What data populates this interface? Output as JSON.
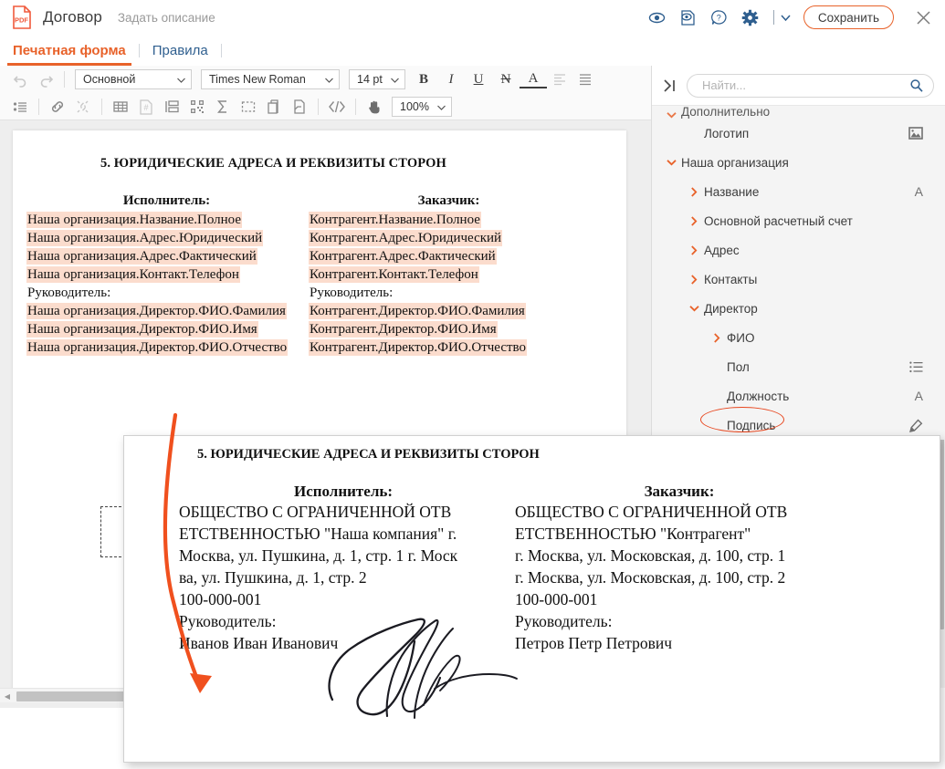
{
  "topbar": {
    "app_icon": "pdf-file-icon",
    "title": "Договор",
    "description_placeholder": "Задать описание",
    "icons": [
      {
        "name": "eye-icon",
        "label": "Просмотр"
      },
      {
        "name": "preview-page-icon",
        "label": "Предпросмотр"
      },
      {
        "name": "help-icon",
        "label": "Справка"
      },
      {
        "name": "gear-icon",
        "label": "Настройки"
      }
    ],
    "dropdown_caret": "chevron-down-icon",
    "save_label": "Сохранить",
    "close_label": "×"
  },
  "tabs": [
    {
      "label": "Печатная форма",
      "active": true
    },
    {
      "label": "Правила",
      "active": false
    }
  ],
  "toolbar": {
    "undo": "undo-icon",
    "redo": "redo-icon",
    "style_value": "Основной",
    "font_value": "Times New Roman",
    "size_value": "14 pt",
    "bold": "B",
    "italic": "I",
    "underline": "U",
    "strikethrough": "N",
    "font_color": "A",
    "align_left": "align-left-icon",
    "align_justify": "align-justify-icon",
    "list": "bullet-list-icon",
    "link": "link-icon",
    "unlink": "unlink-icon",
    "table": "table-icon",
    "page_number": "page-number-icon",
    "paragraph": "paragraph-icon",
    "barcode": "qr-code-icon",
    "sum": "sum-icon",
    "selection": "selection-icon",
    "copy_page": "copy-page-icon",
    "page_break": "page-break-icon",
    "code": "code-icon",
    "hand": "hand-icon",
    "zoom_value": "100%"
  },
  "document": {
    "section_title": "5. ЮРИДИЧЕСКИЕ АДРЕСА И РЕКВИЗИТЫ СТОРОН",
    "left_column": {
      "header": "Исполнитель:",
      "lines": [
        {
          "text": "Наша организация.Название.Полное",
          "field": true
        },
        {
          "text": "Наша организация.Адрес.Юридический",
          "field": true
        },
        {
          "text": "Наша организация.Адрес.Фактический",
          "field": true
        },
        {
          "text": "Наша организация.Контакт.Телефон",
          "field": true
        },
        {
          "text": "Руководитель:",
          "field": false
        },
        {
          "text": "Наша организация.Директор.ФИО.Фамилия",
          "field": true
        },
        {
          "text": "Наша организация.Директор.ФИО.Имя",
          "field": true
        },
        {
          "text": "Наша организация.Директор.ФИО.Отчество",
          "field": true
        }
      ]
    },
    "right_column": {
      "header": "Заказчик:",
      "lines": [
        {
          "text": "Контрагент.Название.Полное",
          "field": true
        },
        {
          "text": "Контрагент.Адрес.Юридический",
          "field": true
        },
        {
          "text": "Контрагент.Адрес.Фактический",
          "field": true
        },
        {
          "text": "Контрагент.Контакт.Телефон",
          "field": true
        },
        {
          "text": "Руководитель:",
          "field": false
        },
        {
          "text": "Контрагент.Директор.ФИО.Фамилия",
          "field": true
        },
        {
          "text": "Контрагент.Директор.ФИО.Имя",
          "field": true
        },
        {
          "text": "Контрагент.Директор.ФИО.Отчество",
          "field": true
        }
      ]
    },
    "signature_placeholder": "Подпись"
  },
  "sidebar": {
    "collapse_icon": "collapse-panel-icon",
    "search_placeholder": "Найти...",
    "search_value": "",
    "search_icon": "search-icon",
    "tree": [
      {
        "label": "Дополнительно",
        "level": 0,
        "expanded": true,
        "twisty": "chevron-down-icon",
        "icon": "",
        "partial": true
      },
      {
        "label": "Логотип",
        "level": 1,
        "expanded": null,
        "twisty": "",
        "icon": "image-icon"
      },
      {
        "label": "Наша организация",
        "level": 0,
        "expanded": true,
        "twisty": "chevron-down-icon",
        "icon": ""
      },
      {
        "label": "Название",
        "level": 1,
        "expanded": false,
        "twisty": "chevron-right-icon",
        "icon": "text-icon"
      },
      {
        "label": "Основной расчетный счет",
        "level": 1,
        "expanded": false,
        "twisty": "chevron-right-icon",
        "icon": ""
      },
      {
        "label": "Адрес",
        "level": 1,
        "expanded": false,
        "twisty": "chevron-right-icon",
        "icon": ""
      },
      {
        "label": "Контакты",
        "level": 1,
        "expanded": false,
        "twisty": "chevron-right-icon",
        "icon": ""
      },
      {
        "label": "Директор",
        "level": 1,
        "expanded": true,
        "twisty": "chevron-down-icon",
        "icon": ""
      },
      {
        "label": "ФИО",
        "level": 2,
        "expanded": false,
        "twisty": "chevron-right-icon",
        "icon": ""
      },
      {
        "label": "Пол",
        "level": 2,
        "expanded": null,
        "twisty": "",
        "icon": "list-icon"
      },
      {
        "label": "Должность",
        "level": 2,
        "expanded": null,
        "twisty": "",
        "icon": "text-icon"
      },
      {
        "label": "Подпись",
        "level": 2,
        "expanded": null,
        "twisty": "",
        "icon": "signature-pen-icon",
        "highlighted": true
      }
    ]
  },
  "preview": {
    "section_title": "5. ЮРИДИЧЕСКИЕ АДРЕСА И РЕКВИЗИТЫ СТОРОН",
    "left_column": {
      "header": "Исполнитель:",
      "lines": [
        "ОБЩЕСТВО С ОГРАНИЧЕННОЙ ОТВ",
        "ЕТСТВЕННОСТЬЮ \"Наша компания\" г.",
        "Москва, ул. Пушкина, д. 1, стр. 1 г. Моск",
        "ва, ул. Пушкина, д. 1, стр. 2",
        "100-000-001",
        "Руководитель:",
        "Иванов Иван Иванович"
      ]
    },
    "right_column": {
      "header": "Заказчик:",
      "lines": [
        "ОБЩЕСТВО С ОГРАНИЧЕННОЙ ОТВ",
        "ЕТСТВЕННОСТЬЮ \"Контрагент\"",
        "г. Москва, ул. Московская, д. 100, стр. 1",
        "г. Москва, ул. Московская, д. 100, стр. 2",
        "100-000-001",
        "Руководитель:",
        "Петров Петр Петрович"
      ]
    },
    "signature_image": "handwritten-signature"
  },
  "annotation": {
    "arrow": "curved-arrow",
    "arrow_color": "#f0501e",
    "ellipse_color": "#e8461e"
  },
  "colors": {
    "accent": "#e8622a",
    "link": "#2f5f8f",
    "field_highlight": "#fbdccd",
    "panel_bg": "#f4f4f4",
    "editor_bg": "#eeeeee"
  }
}
